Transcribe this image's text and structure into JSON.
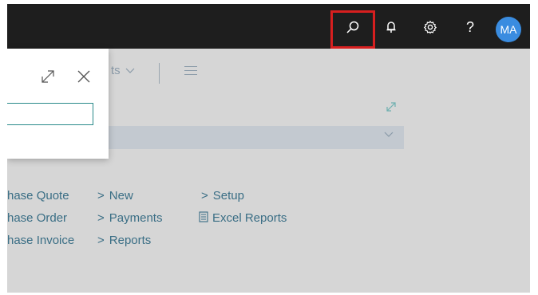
{
  "topbar": {
    "avatar_initials": "MA",
    "icons": [
      "search-icon",
      "bell-icon",
      "gear-icon",
      "help-icon"
    ],
    "help_glyph": "?"
  },
  "toolbar": {
    "partial_actions_label": "ts",
    "menu_icon": "hamburger-icon"
  },
  "panel": {
    "search_value": "",
    "expand_icon": "expand-icon",
    "close_icon": "close-icon"
  },
  "links": {
    "col1": [
      "hase Quote",
      "hase Order",
      "hase Invoice"
    ],
    "col2": [
      "New",
      "Payments",
      "Reports"
    ],
    "col3": [
      "Setup"
    ],
    "excel_reports": "Excel Reports",
    "gt_glyph": ">"
  },
  "colors": {
    "topbar_bg": "#1e1e1e",
    "avatar_bg": "#3a8ce0",
    "highlight": "#d71f1f",
    "link": "#3a6e85"
  }
}
